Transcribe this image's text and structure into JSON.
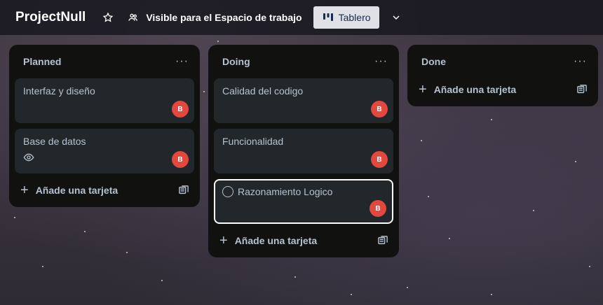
{
  "header": {
    "board_title": "ProjectNull",
    "visibility_label": "Visible para el Espacio de trabajo",
    "view_label": "Tablero"
  },
  "lists": [
    {
      "title": "Planned",
      "menu": "···",
      "cards": [
        {
          "title": "Interfaz y diseño",
          "avatar": "B",
          "watching": false,
          "selected": false
        },
        {
          "title": "Base de datos",
          "avatar": "B",
          "watching": true,
          "selected": false
        }
      ],
      "add_label": "Añade una tarjeta"
    },
    {
      "title": "Doing",
      "menu": "···",
      "cards": [
        {
          "title": "Calidad del codigo",
          "avatar": "B",
          "watching": false,
          "selected": false
        },
        {
          "title": "Funcionalidad",
          "avatar": "B",
          "watching": false,
          "selected": false
        },
        {
          "title": "Razonamiento Logico",
          "avatar": "B",
          "watching": false,
          "selected": true
        }
      ],
      "add_label": "Añade una tarjeta"
    },
    {
      "title": "Done",
      "menu": "···",
      "cards": [],
      "add_label": "Añade una tarjeta"
    }
  ],
  "colors": {
    "avatar": "#e2483d",
    "list_bg": "#111210",
    "card_bg": "#22272b",
    "view_button_bg": "#dfe1e6"
  }
}
